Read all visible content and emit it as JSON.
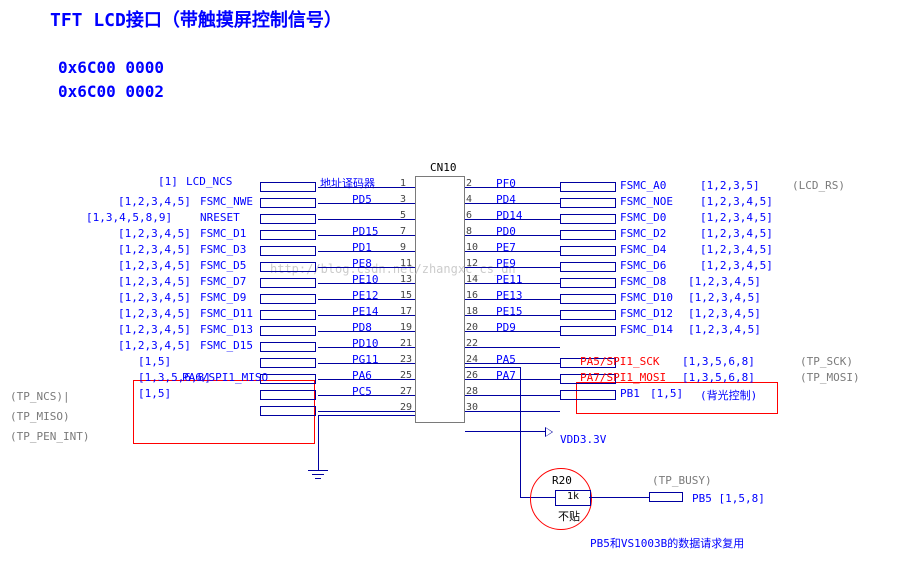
{
  "title": "TFT LCD接口（带触摸屏控制信号）",
  "addresses": [
    "0x6C00 0000",
    "0x6C00 0002"
  ],
  "connector": {
    "refdes": "CN10",
    "pins": 30
  },
  "addr_decoder_label": "地址译码器",
  "left_pins": [
    {
      "pin": 1,
      "net": "",
      "bus": "",
      "signal": "",
      "sheets": ""
    },
    {
      "pin": 3,
      "net": "PD5",
      "bus": "[1,2,3,4,5]",
      "signal": "FSMC_NWE",
      "sheets": ""
    },
    {
      "pin": 5,
      "net": "",
      "bus": "[1,3,4,5,8,9]",
      "signal": "NRESET",
      "sheets": ""
    },
    {
      "pin": 7,
      "net": "PD15",
      "bus": "[1,2,3,4,5]",
      "signal": "FSMC_D1",
      "sheets": ""
    },
    {
      "pin": 9,
      "net": "PD1",
      "bus": "[1,2,3,4,5]",
      "signal": "FSMC_D3",
      "sheets": ""
    },
    {
      "pin": 11,
      "net": "PE8",
      "bus": "[1,2,3,4,5]",
      "signal": "FSMC_D5",
      "sheets": ""
    },
    {
      "pin": 13,
      "net": "PE10",
      "bus": "[1,2,3,4,5]",
      "signal": "FSMC_D7",
      "sheets": ""
    },
    {
      "pin": 15,
      "net": "PE12",
      "bus": "[1,2,3,4,5]",
      "signal": "FSMC_D9",
      "sheets": ""
    },
    {
      "pin": 17,
      "net": "PE14",
      "bus": "[1,2,3,4,5]",
      "signal": "FSMC_D11",
      "sheets": ""
    },
    {
      "pin": 19,
      "net": "PD8",
      "bus": "[1,2,3,4,5]",
      "signal": "FSMC_D13",
      "sheets": ""
    },
    {
      "pin": 21,
      "net": "PD10",
      "bus": "[1,2,3,4,5]",
      "signal": "FSMC_D15",
      "sheets": ""
    },
    {
      "pin": 23,
      "net": "PG11",
      "bus": "[1,5]",
      "signal": "",
      "sheets": ""
    },
    {
      "pin": 25,
      "net": "PA6",
      "bus": "[1,3,5,6,8]",
      "signal": "PA6/SPI1_MISO",
      "sheets": ""
    },
    {
      "pin": 27,
      "net": "PC5",
      "bus": "[1,5]",
      "signal": "",
      "sheets": ""
    },
    {
      "pin": 29,
      "net": "",
      "bus": "",
      "signal": "",
      "sheets": ""
    }
  ],
  "left_extra": {
    "lcd_ncs": {
      "sheets": "[1]",
      "signal": "LCD_NCS"
    },
    "tp_ncs": "(TP_NCS)|",
    "tp_miso": "(TP_MISO)",
    "tp_pen_int": "(TP_PEN_INT)"
  },
  "right_pins": [
    {
      "pin": 2,
      "net": "PF0",
      "signal": "FSMC_A0",
      "sheets": "[1,2,3,5]",
      "extra": "(LCD_RS)"
    },
    {
      "pin": 4,
      "net": "PD4",
      "signal": "FSMC_NOE",
      "sheets": "[1,2,3,4,5]",
      "extra": ""
    },
    {
      "pin": 6,
      "net": "PD14",
      "signal": "FSMC_D0",
      "sheets": "[1,2,3,4,5]",
      "extra": ""
    },
    {
      "pin": 8,
      "net": "PD0",
      "signal": "FSMC_D2",
      "sheets": "[1,2,3,4,5]",
      "extra": ""
    },
    {
      "pin": 10,
      "net": "PE7",
      "signal": "FSMC_D4",
      "sheets": "[1,2,3,4,5]",
      "extra": ""
    },
    {
      "pin": 12,
      "net": "PE9",
      "signal": "FSMC_D6",
      "sheets": "[1,2,3,4,5]",
      "extra": ""
    },
    {
      "pin": 14,
      "net": "PE11",
      "signal": "FSMC_D8",
      "sheets": "[1,2,3,4,5]",
      "extra": ""
    },
    {
      "pin": 16,
      "net": "PE13",
      "signal": "FSMC_D10",
      "sheets": "[1,2,3,4,5]",
      "extra": ""
    },
    {
      "pin": 18,
      "net": "PE15",
      "signal": "FSMC_D12",
      "sheets": "[1,2,3,4,5]",
      "extra": ""
    },
    {
      "pin": 20,
      "net": "PD9",
      "signal": "FSMC_D14",
      "sheets": "[1,2,3,4,5]",
      "extra": ""
    },
    {
      "pin": 22,
      "net": "",
      "signal": "",
      "sheets": "",
      "extra": ""
    },
    {
      "pin": 24,
      "net": "PA5",
      "signal": "PA5/SPI1_SCK",
      "sheets": "[1,3,5,6,8]",
      "extra": "(TP_SCK)"
    },
    {
      "pin": 26,
      "net": "PA7",
      "signal": "PA7/SPI1_MOSI",
      "sheets": "[1,3,5,6,8]",
      "extra": "(TP_MOSI)"
    },
    {
      "pin": 28,
      "net": "",
      "signal": "PB1",
      "sheets": "[1,5]",
      "extra": "(背光控制)"
    },
    {
      "pin": 30,
      "net": "",
      "signal": "VDD3.3V",
      "sheets": "",
      "extra": ""
    }
  ],
  "resistor": {
    "refdes": "R20",
    "value": "1k",
    "note": "不贴"
  },
  "tp_busy": {
    "label": "(TP_BUSY)",
    "net": "PB5",
    "sheets": "[1,5,8]"
  },
  "note_bottom": "PB5和VS1003B的数据请求复用",
  "watermark": "http://blog.csdn.net/zhangxc_cs_dn"
}
